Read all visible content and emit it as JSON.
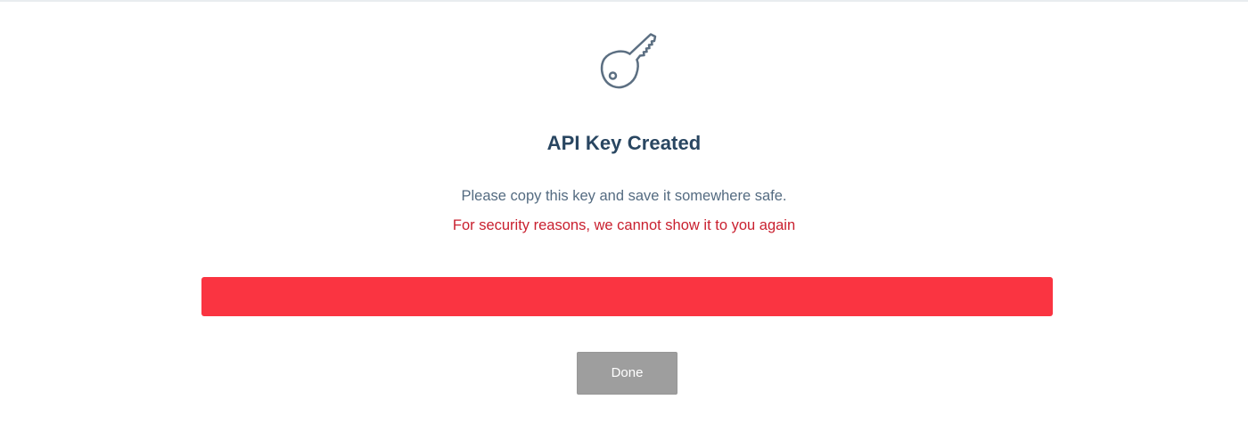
{
  "dialog": {
    "icon": "key-icon",
    "title": "API Key Created",
    "message": "Please copy this key and save it somewhere safe.",
    "warning": "For security reasons, we cannot show it to you again",
    "key_bar_color": "#fa3441",
    "done_label": "Done"
  },
  "colors": {
    "title": "#294661",
    "message": "#546b81",
    "warning": "#c9202f",
    "done_button": "#9e9e9e"
  }
}
